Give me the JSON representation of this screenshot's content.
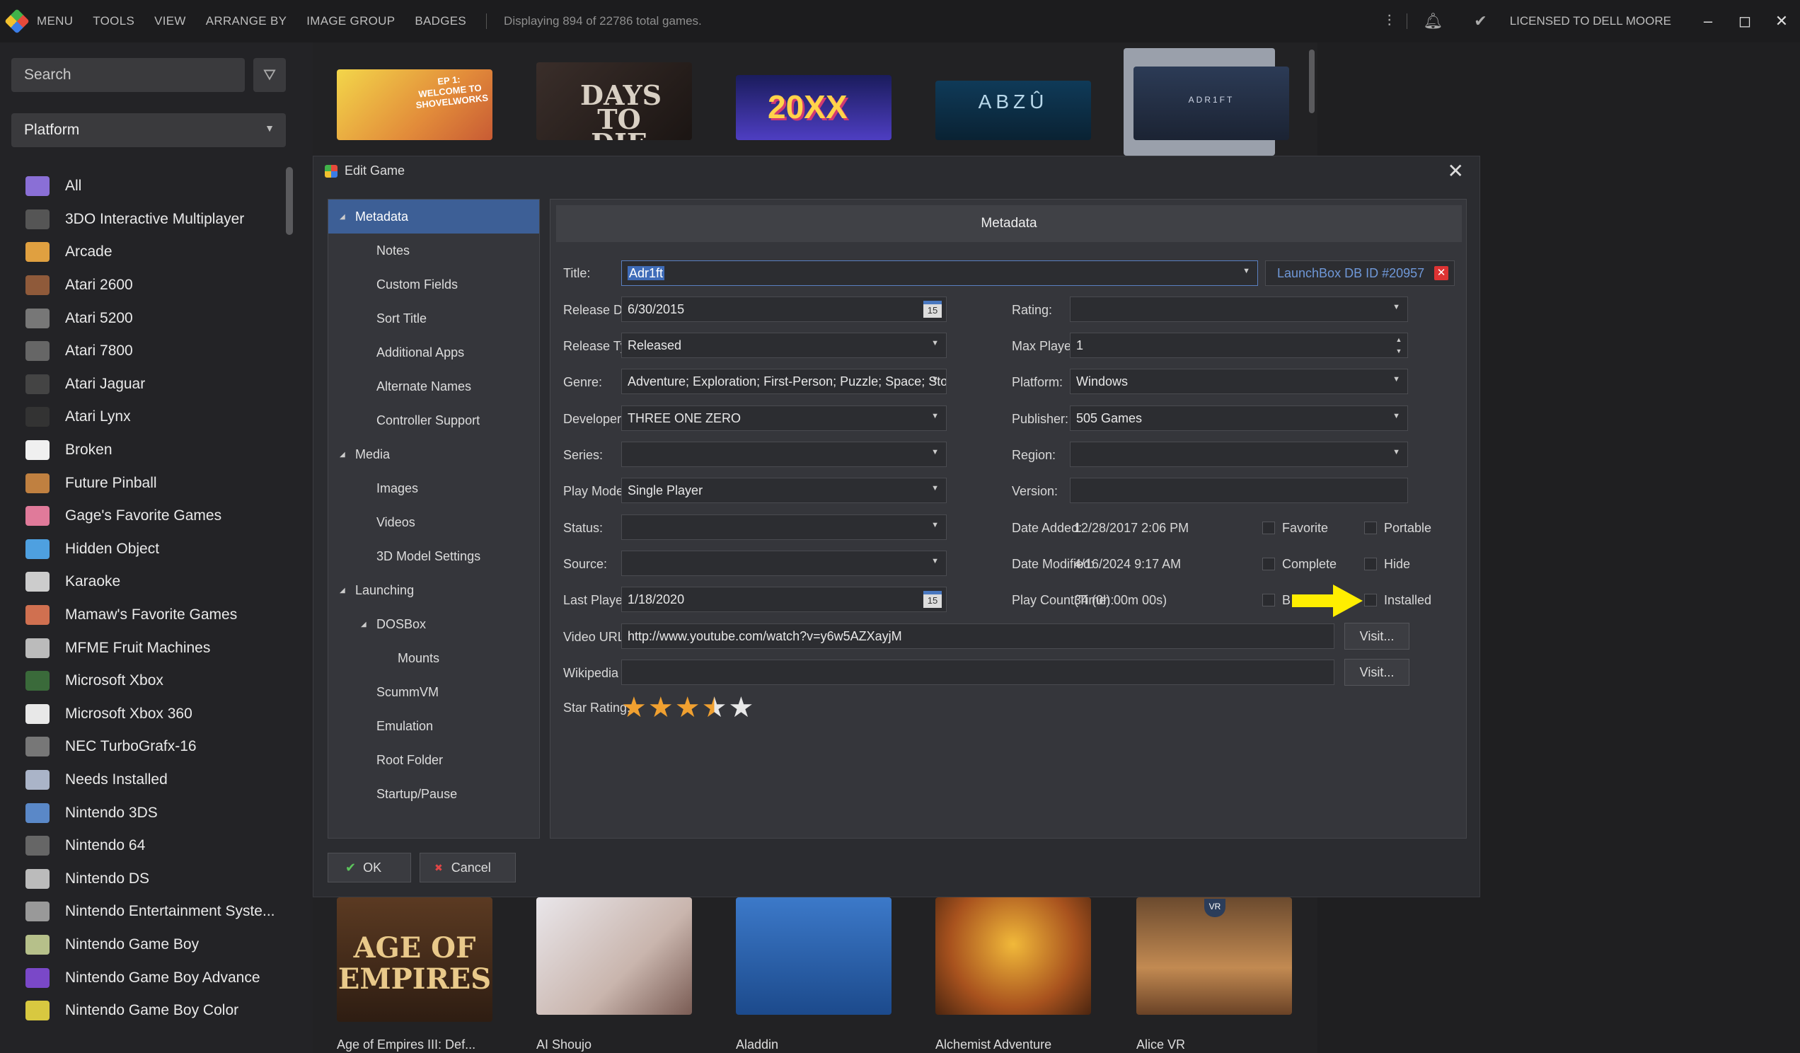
{
  "topbar": {
    "menu": [
      "MENU",
      "TOOLS",
      "VIEW",
      "ARRANGE BY",
      "IMAGE GROUP",
      "BADGES"
    ],
    "status": "Displaying 894 of 22786 total games.",
    "license": "LICENSED TO DELL MOORE"
  },
  "sidebar": {
    "search_placeholder": "Search",
    "platform_select": "Platform",
    "items": [
      "All",
      "3DO Interactive Multiplayer",
      "Arcade",
      "Atari 2600",
      "Atari 5200",
      "Atari 7800",
      "Atari Jaguar",
      "Atari Lynx",
      "Broken",
      "Future Pinball",
      "Gage's Favorite Games",
      "Hidden Object",
      "Karaoke",
      "Mamaw's Favorite Games",
      "MFME Fruit Machines",
      "Microsoft Xbox",
      "Microsoft Xbox 360",
      "NEC TurboGrafx-16",
      "Needs Installed",
      "Nintendo 3DS",
      "Nintendo 64",
      "Nintendo DS",
      "Nintendo Entertainment Syste...",
      "Nintendo Game Boy",
      "Nintendo Game Boy Advance",
      "Nintendo Game Boy Color"
    ]
  },
  "gallery": {
    "top_tiles": [
      "EP 1: WELCOME TO SHOVELWORKS",
      "DAYS TO DIE",
      "20XX",
      "ABZÛ",
      "ADR1FT"
    ],
    "bottom_tiles": [
      "AGE OF EMPIRES",
      "",
      "",
      "",
      "VR"
    ],
    "bottom_labels": [
      "Age of Empires III: Def...",
      "AI Shoujo",
      "Aladdin",
      "Alchemist Adventure",
      "Alice VR"
    ]
  },
  "dialog": {
    "title": "Edit Game",
    "nav": [
      {
        "label": "Metadata",
        "level": 0,
        "tri": "◢",
        "selected": true
      },
      {
        "label": "Notes",
        "level": 1
      },
      {
        "label": "Custom Fields",
        "level": 1
      },
      {
        "label": "Sort Title",
        "level": 1
      },
      {
        "label": "Additional Apps",
        "level": 1
      },
      {
        "label": "Alternate Names",
        "level": 1
      },
      {
        "label": "Controller Support",
        "level": 1
      },
      {
        "label": "Media",
        "level": 0,
        "tri": "◢"
      },
      {
        "label": "Images",
        "level": 1
      },
      {
        "label": "Videos",
        "level": 1
      },
      {
        "label": "3D Model Settings",
        "level": 1
      },
      {
        "label": "Launching",
        "level": 0,
        "tri": "◢"
      },
      {
        "label": "DOSBox",
        "level": 1,
        "tri": "◢"
      },
      {
        "label": "Mounts",
        "level": 2
      },
      {
        "label": "ScummVM",
        "level": 1
      },
      {
        "label": "Emulation",
        "level": 1
      },
      {
        "label": "Root Folder",
        "level": 1
      },
      {
        "label": "Startup/Pause",
        "level": 1
      }
    ],
    "section_header": "Metadata",
    "labels": {
      "title": "Title:",
      "release_date": "Release Date:",
      "release_type": "Release Type:",
      "genre": "Genre:",
      "developer": "Developer:",
      "series": "Series:",
      "play_mode": "Play Mode:",
      "status": "Status:",
      "source": "Source:",
      "last_played": "Last Played:",
      "video_url": "Video URL:",
      "wikipedia_url": "Wikipedia URL:",
      "star_rating": "Star Rating:",
      "rating": "Rating:",
      "max_players": "Max Players:",
      "platform": "Platform:",
      "publisher": "Publisher:",
      "region": "Region:",
      "version": "Version:",
      "date_added": "Date Added:",
      "date_modified": "Date Modified:",
      "play_count": "Play Count(Time):"
    },
    "values": {
      "title": "Adr1ft",
      "launchbox_id": "LaunchBox DB ID #20957",
      "release_date": "6/30/2015",
      "release_type": "Released",
      "genre": "Adventure; Exploration; First-Person; Puzzle; Space; Sto",
      "developer": "THREE ONE ZERO",
      "series": "",
      "play_mode": "Single Player",
      "status": "",
      "source": "",
      "last_played": "1/18/2020",
      "video_url": "http://www.youtube.com/watch?v=y6w5AZXayjM",
      "wikipedia_url": "",
      "rating": "",
      "max_players": "1",
      "platform": "Windows",
      "publisher": "505 Games",
      "region": "",
      "version": "",
      "date_added": "12/28/2017 2:06 PM",
      "date_modified": "4/16/2024 9:17 AM",
      "play_count": "34 (0h 00m 00s)",
      "star_rating": 3.5
    },
    "checkboxes": {
      "favorite": "Favorite",
      "portable": "Portable",
      "complete": "Complete",
      "hide": "Hide",
      "broken_partial": "B",
      "installed": "Installed"
    },
    "buttons": {
      "visit": "Visit...",
      "ok": "OK",
      "cancel": "Cancel"
    },
    "calendar_day": "15"
  }
}
